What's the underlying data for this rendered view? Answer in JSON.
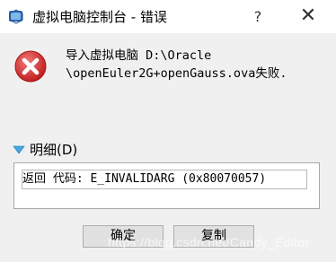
{
  "window": {
    "title": "虚拟电脑控制台 - 错误",
    "help_label": "?",
    "close_label": "✕",
    "app_icon": "virtualbox-icon"
  },
  "message": {
    "icon": "error-icon",
    "text": "导入虚拟电脑 D:\\Oracle\n\\openEuler2G+openGauss.ova失败."
  },
  "details": {
    "toggle_label": "明细(D)",
    "text": "返回 代码: E_INVALIDARG (0x80070057)"
  },
  "buttons": {
    "ok_label": "确定",
    "copy_label": "复制"
  },
  "watermark": "https://blog.csdn.net/Candy_Editor",
  "colors": {
    "error_red": "#d93a3a",
    "expander_blue": "#45a6e0",
    "background": "#f0f0f0"
  }
}
